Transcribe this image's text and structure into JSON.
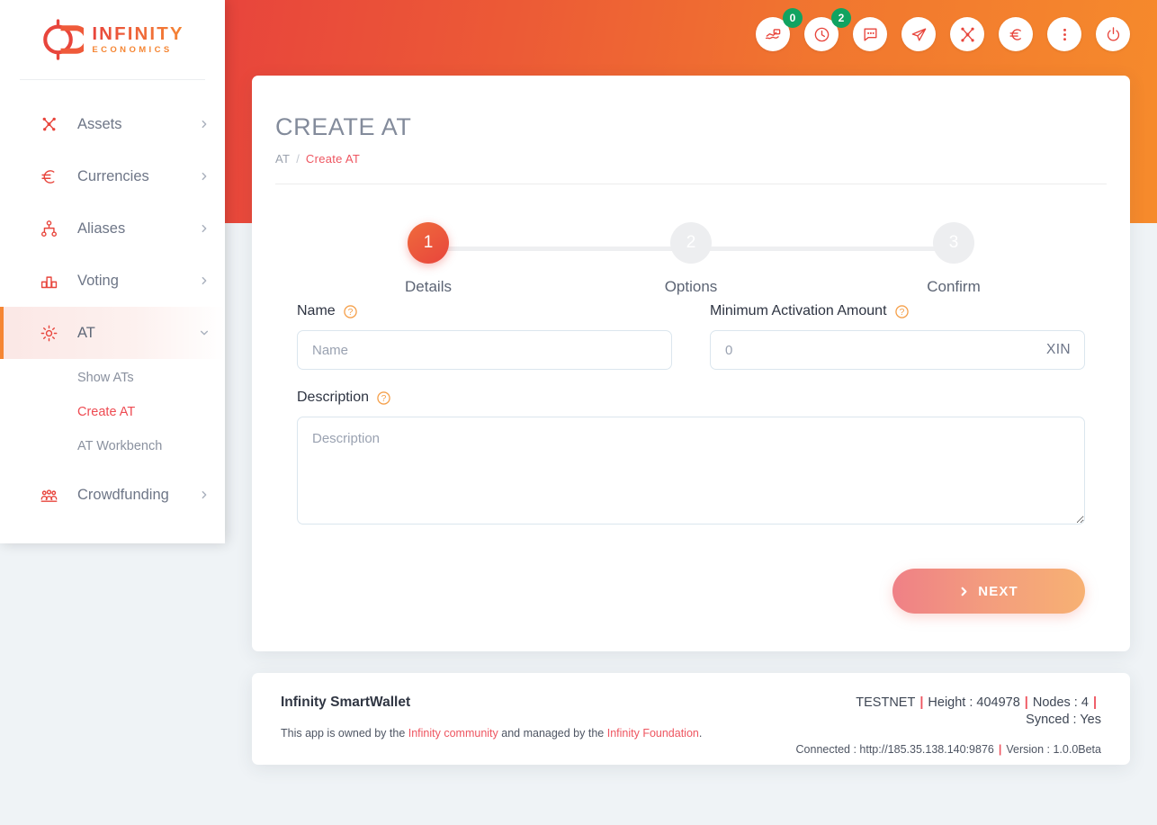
{
  "brand": {
    "logo_title": "INFINITY",
    "logo_subtitle": "ECONOMICS",
    "logo_icon": "infinity-coin-logo"
  },
  "topbar": {
    "icons": [
      {
        "name": "transactions-icon",
        "badge": "0"
      },
      {
        "name": "pending-clock-icon",
        "badge": "2"
      },
      {
        "name": "messages-icon",
        "badge": null
      },
      {
        "name": "send-icon",
        "badge": null
      },
      {
        "name": "assets-network-icon",
        "badge": null
      },
      {
        "name": "currency-euro-icon",
        "badge": null
      },
      {
        "name": "more-options-icon",
        "badge": null
      },
      {
        "name": "power-logout-icon",
        "badge": null
      }
    ]
  },
  "sidebar": {
    "items": [
      {
        "label": "Assets",
        "icon": "network-nodes-icon",
        "chevron": "chevron-right-icon",
        "active": false
      },
      {
        "label": "Currencies",
        "icon": "euro-icon",
        "chevron": "chevron-right-icon",
        "active": false
      },
      {
        "label": "Aliases",
        "icon": "sitemap-icon",
        "chevron": "chevron-right-icon",
        "active": false
      },
      {
        "label": "Voting",
        "icon": "bar-chart-icon",
        "chevron": "chevron-right-icon",
        "active": false
      },
      {
        "label": "AT",
        "icon": "gear-icon",
        "chevron": "chevron-down-icon",
        "active": true
      },
      {
        "label": "Crowdfunding",
        "icon": "people-group-icon",
        "chevron": "chevron-right-icon",
        "active": false
      }
    ],
    "submenu": [
      {
        "label": "Show ATs",
        "active": false
      },
      {
        "label": "Create AT",
        "active": true
      },
      {
        "label": "AT Workbench",
        "active": false
      }
    ]
  },
  "page": {
    "title": "CREATE AT",
    "breadcrumb": {
      "parent": "AT",
      "separator": "/",
      "current": "Create AT"
    }
  },
  "stepper": {
    "steps": [
      {
        "number": "1",
        "label": "Details",
        "state": "current"
      },
      {
        "number": "2",
        "label": "Options",
        "state": "upcoming"
      },
      {
        "number": "3",
        "label": "Confirm",
        "state": "upcoming"
      }
    ]
  },
  "form": {
    "name": {
      "label": "Name",
      "help_icon": "question-mark-icon",
      "value": "",
      "placeholder": "Name"
    },
    "min_activation": {
      "label": "Minimum Activation Amount",
      "help_icon": "question-mark-icon",
      "value": "",
      "placeholder": "0",
      "suffix": "XIN"
    },
    "description": {
      "label": "Description",
      "help_icon": "question-mark-icon",
      "value": "",
      "placeholder": "Description"
    },
    "next_button": {
      "label": "NEXT",
      "icon": "chevron-right-icon"
    }
  },
  "footer": {
    "title": "Infinity SmartWallet",
    "note_prefix": "This app is owned by the ",
    "link_community": "Infinity community",
    "note_middle": " and managed by the ",
    "link_foundation": "Infinity Foundation",
    "note_suffix": ".",
    "network": "TESTNET",
    "height": "Height : 404978",
    "nodes": "Nodes : 4",
    "synced": "Synced : Yes",
    "connected": "Connected : http://185.35.138.140:9876",
    "version": "Version : 1.0.0Beta",
    "separator": "|"
  },
  "colors": {
    "brand_red": "#e8453c",
    "brand_orange": "#f58634",
    "badge_green": "#11a361",
    "link_red": "#ee5560",
    "page_bg": "#eff3f6"
  }
}
